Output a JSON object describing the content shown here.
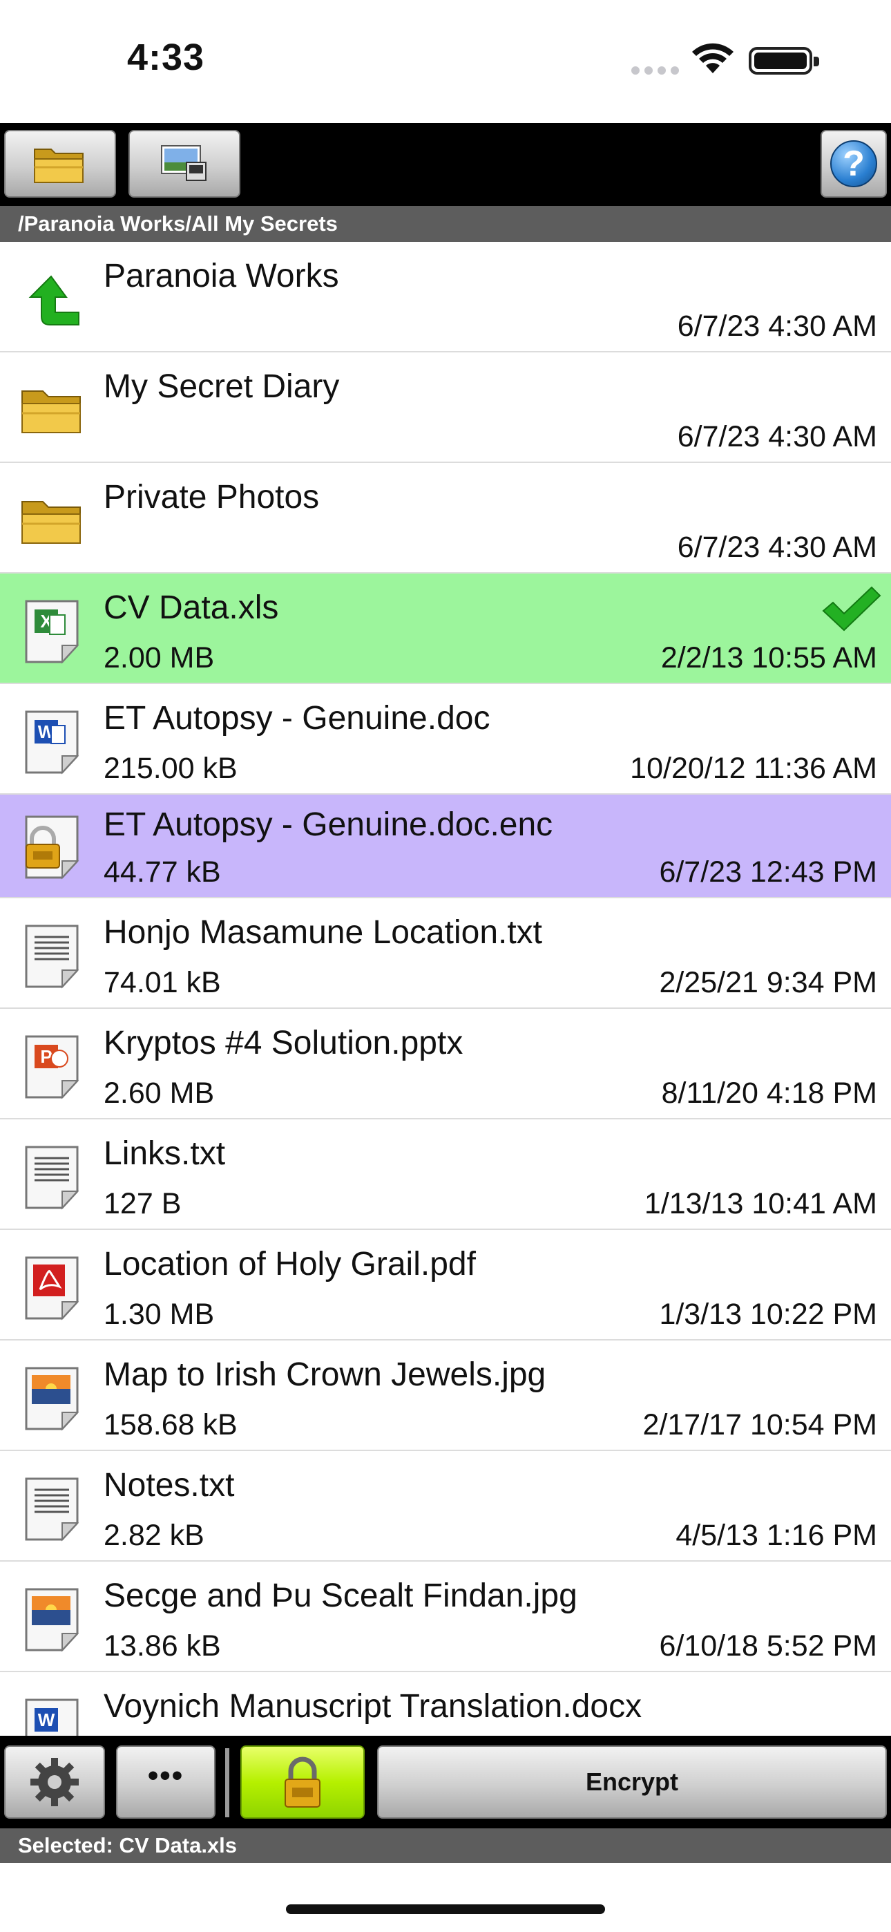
{
  "status": {
    "time": "4:33"
  },
  "toolbar": {
    "help_label": "?"
  },
  "path": "/Paranoia Works/All My Secrets",
  "files": [
    {
      "name": "Paranoia Works",
      "size": "",
      "date": "6/7/23 4:30 AM",
      "icon": "up-arrow-icon"
    },
    {
      "name": "My Secret Diary",
      "size": "",
      "date": "6/7/23 4:30 AM",
      "icon": "folder-icon"
    },
    {
      "name": "Private Photos",
      "size": "",
      "date": "6/7/23 4:30 AM",
      "icon": "folder-icon"
    },
    {
      "name": "CV Data.xls",
      "size": "2.00 MB",
      "date": "2/2/13 10:55 AM",
      "icon": "excel-file-icon",
      "selected": true
    },
    {
      "name": "ET Autopsy - Genuine.doc",
      "size": "215.00 kB",
      "date": "10/20/12 11:36 AM",
      "icon": "word-file-icon"
    },
    {
      "name": "ET Autopsy - Genuine.doc.enc",
      "size": "44.77 kB",
      "date": "6/7/23 12:43 PM",
      "icon": "encrypted-file-icon",
      "encrypted": true
    },
    {
      "name": "Honjo Masamune Location.txt",
      "size": "74.01 kB",
      "date": "2/25/21 9:34 PM",
      "icon": "text-file-icon"
    },
    {
      "name": "Kryptos #4 Solution.pptx",
      "size": "2.60 MB",
      "date": "8/11/20 4:18 PM",
      "icon": "powerpoint-file-icon"
    },
    {
      "name": "Links.txt",
      "size": "127 B",
      "date": "1/13/13 10:41 AM",
      "icon": "text-file-icon"
    },
    {
      "name": "Location of Holy Grail.pdf",
      "size": "1.30 MB",
      "date": "1/3/13 10:22 PM",
      "icon": "pdf-file-icon"
    },
    {
      "name": "Map to Irish Crown Jewels.jpg",
      "size": "158.68 kB",
      "date": "2/17/17 10:54 PM",
      "icon": "image-file-icon"
    },
    {
      "name": "Notes.txt",
      "size": "2.82 kB",
      "date": "4/5/13 1:16 PM",
      "icon": "text-file-icon"
    },
    {
      "name": "Secge and Þu Scealt Findan.jpg",
      "size": "13.86 kB",
      "date": "6/10/18 5:52 PM",
      "icon": "image-file-icon"
    },
    {
      "name": "Voynich Manuscript Translation.docx",
      "size": "",
      "date": "",
      "icon": "word-file-icon"
    }
  ],
  "bottom": {
    "more_label": "•••",
    "encrypt_label": "Encrypt"
  },
  "selection": "Selected: CV Data.xls",
  "colors": {
    "selected_row": "#9cf59c",
    "encrypted_row": "#c8b6fb",
    "lock_button": "#b6f000"
  }
}
